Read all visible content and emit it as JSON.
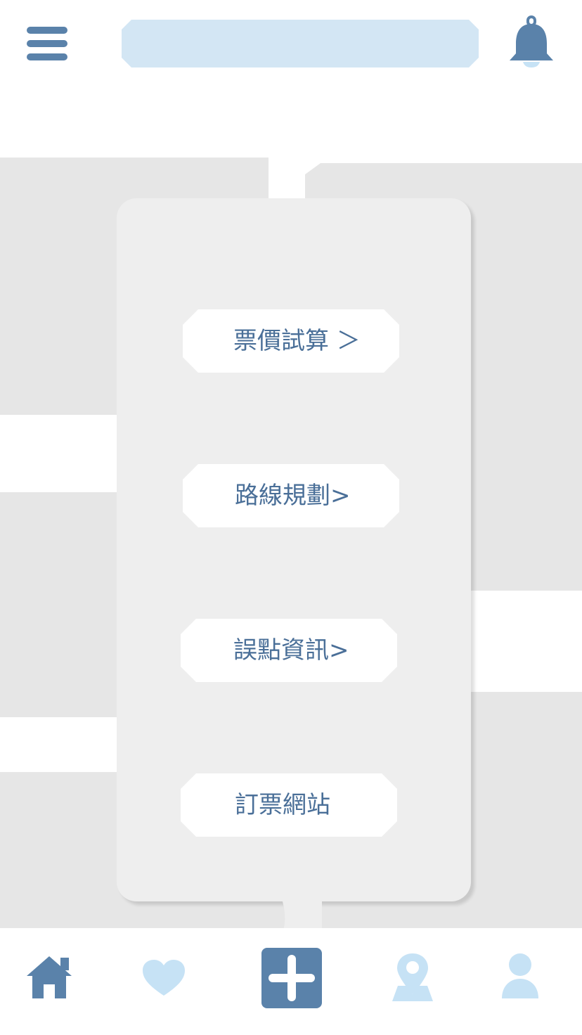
{
  "header": {
    "menu_icon": "hamburger-menu-icon",
    "search": {
      "value": "",
      "placeholder": ""
    },
    "notification_icon": "bell-icon"
  },
  "popup_menu": {
    "items": [
      {
        "label": "票價試算 ＞"
      },
      {
        "label": "路線規劃>"
      },
      {
        "label": "誤點資訊>"
      },
      {
        "label": "訂票網站"
      }
    ]
  },
  "bottom_nav": {
    "items": [
      {
        "icon": "home-icon",
        "color": "#5a82aa",
        "active": true
      },
      {
        "icon": "heart-icon",
        "color": "#c6e2f5",
        "active": false
      },
      {
        "icon": "plus-icon",
        "color": "#5a82aa",
        "active": true
      },
      {
        "icon": "map-pin-icon",
        "color": "#c6e2f5",
        "active": false
      },
      {
        "icon": "user-icon",
        "color": "#c6e2f5",
        "active": false
      }
    ]
  },
  "colors": {
    "accent": "#5a82aa",
    "accent_light": "#c6e2f5",
    "search_bg": "#d3e6f4",
    "text": "#4a6f98",
    "panel_bg": "#eeeeee",
    "map_block": "#e6e6e6"
  }
}
